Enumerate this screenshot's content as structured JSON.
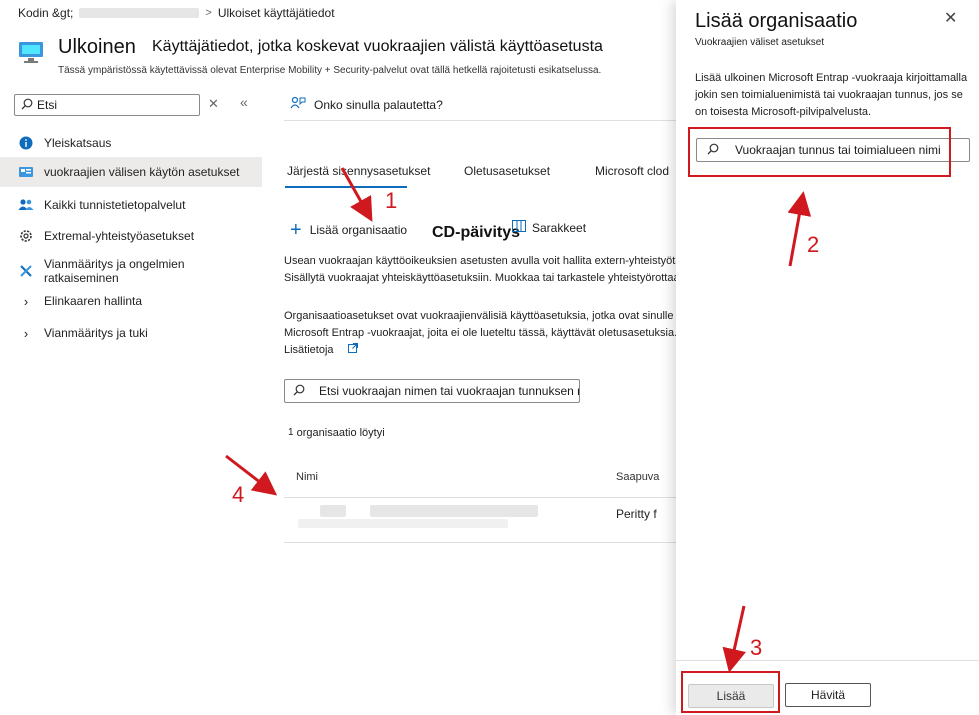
{
  "breadcrumb": {
    "home": "Kodin &gt;",
    "current": "Ulkoiset käyttäjätiedot"
  },
  "header": {
    "title": "Ulkoinen",
    "subtitle": "Käyttäjätiedot, jotka koskevat vuokraajien välistä käyttöasetusta",
    "description": "Tässä ympäristössä käytettävissä olevat Enterprise Mobility + Security-palvelut ovat tällä hetkellä rajoitetusti esikatselussa."
  },
  "sidebar": {
    "search_value": "Etsi",
    "items": [
      {
        "label": "Yleiskatsaus",
        "icon": "info-icon"
      },
      {
        "label": "vuokraajien välisen käytön asetukset",
        "icon": "settings-icon",
        "active": true
      },
      {
        "label": "Kaikki tunnistetietopalvelut",
        "icon": "users-icon"
      },
      {
        "label": "Extremal-yhteistyöasetukset",
        "icon": "gear-icon"
      },
      {
        "label": "Vianmääritys ja ongelmien ratkaiseminen",
        "icon": "wrench-icon"
      },
      {
        "label": "Elinkaaren hallinta",
        "icon": "chevron-right-icon"
      },
      {
        "label": "Vianmääritys ja tuki",
        "icon": "chevron-right-icon"
      }
    ]
  },
  "main": {
    "feedback": "Onko sinulla palautetta?",
    "tabs": [
      "Järjestä sisennysasetukset",
      "Oletusasetukset",
      "Microsoft clod"
    ],
    "add_org": "Lisää organisaatio",
    "cd_update": "CD-päivitys",
    "columns_button": "Sarakkeet",
    "para1_line1": "Usean vuokraajan käyttöoikeuksien asetusten avulla voit hallita extern-yhteistyötä",
    "para1_line2": "Sisällytä vuokraajat yhteiskäyttöasetuksiin. Muokkaa tai tarkastele yhteistyörottaa",
    "para2_line1": "Organisaatioasetukset ovat vuokraajienvälisiä käyttöasetuksia, jotka ovat sinulle mukavat",
    "para2_line2": "Microsoft Entrap -vuokraajat, joita ei ole lueteltu tässä, käyttävät oletusasetuksia.",
    "learn_more": "Lisätietoja",
    "search_placeholder": "Etsi vuokraajan nimen tai vuokraajan tunnuksen mukaan",
    "count_num": "1",
    "count_text": "organisaatio löytyi",
    "table_headers": [
      "Nimi",
      "Saapuva"
    ],
    "table_row": {
      "inbound": "Peritty f"
    }
  },
  "panel": {
    "title": "Lisää organisaatio",
    "subtitle": "Vuokraajien väliset asetukset",
    "description": "Lisää ulkoinen Microsoft Entrap -vuokraaja kirjoittamalla jokin sen toimialuenimistä tai vuokraajan tunnus, jos se on toisesta Microsoft-pilvipalvelusta.",
    "search_placeholder": "Vuokraajan tunnus tai toimialueen nimi",
    "add_button": "Lisää",
    "discard_button": "Hävitä"
  },
  "annotations": {
    "n1": "1",
    "n2": "2",
    "n3": "3",
    "n4": "4"
  },
  "colors": {
    "accent": "#0f6cbd",
    "annotation": "#d0181f"
  }
}
